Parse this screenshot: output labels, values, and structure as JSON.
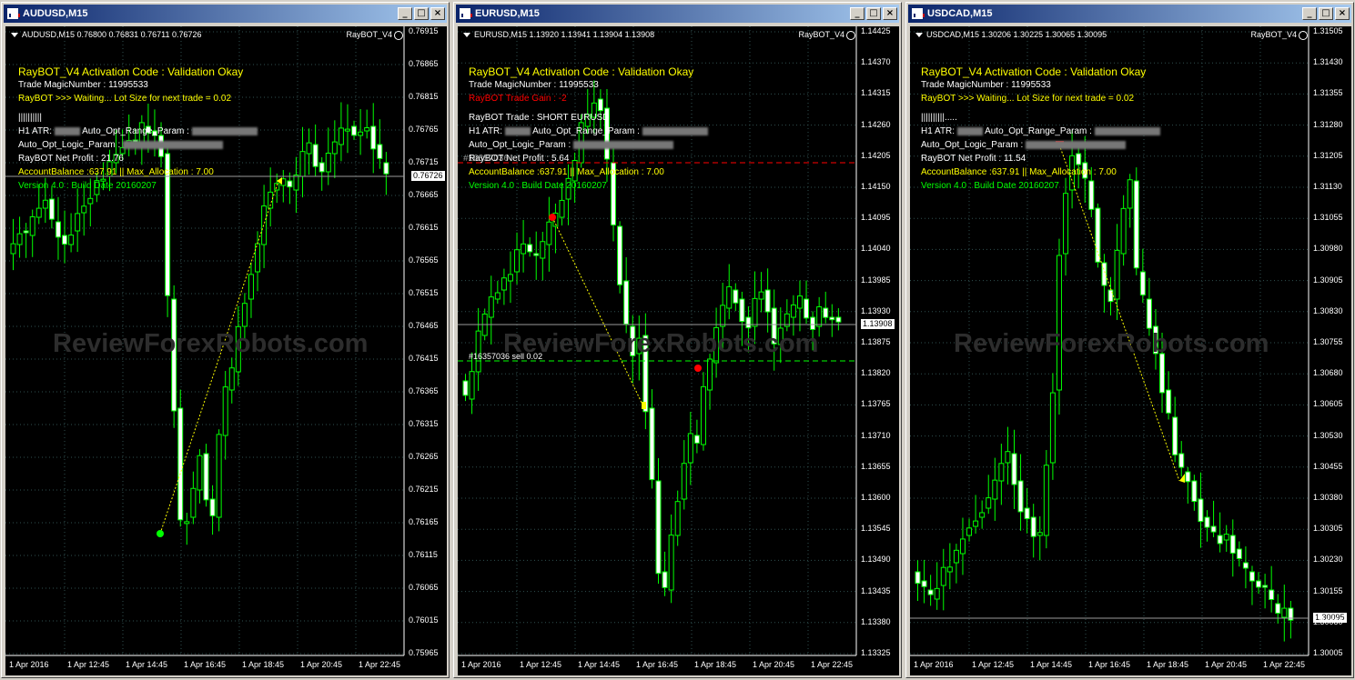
{
  "colors": {
    "bull": "#00ff00",
    "bear": "#00ff00",
    "panel_bg": "#000000",
    "grid": "#2f4f4f",
    "accent_yellow": "#ffff00",
    "red": "#ff0000"
  },
  "windows": [
    {
      "title": "AUDUSD,M15",
      "header": "AUDUSD,M15  0.76800 0.76831 0.76711 0.76726",
      "bot_label": "RayBOT_V4",
      "license": "RayBOT_V4 Activation Code : Validation Okay",
      "magic": "Trade MagicNumber : 11995533",
      "status": "RayBOT >>> Waiting... Lot Size for next trade = 0.02",
      "bars_glyph": "||||||||||",
      "atr_label": "H1 ATR:",
      "range_label": "Auto_Opt_Range_Param :",
      "logic_label": "Auto_Opt_Logic_Param :",
      "net_profit": "RayBOT Net Profit : 21.76",
      "balance": "AccountBalance :637.91 || Max_Allocation : 7.00",
      "version": "Version 4.0 : Build Date 20160207",
      "watermark": "ReviewForexRobots.com",
      "current_price": "0.76726",
      "price_labels": [
        "0.76915",
        "0.76865",
        "0.76815",
        "0.76765",
        "0.76715",
        "0.76665",
        "0.76615",
        "0.76565",
        "0.76515",
        "0.76465",
        "0.76415",
        "0.76365",
        "0.76315",
        "0.76265",
        "0.76215",
        "0.76165",
        "0.76115",
        "0.76065",
        "0.76015",
        "0.75965"
      ],
      "time_labels": [
        "1 Apr 2016",
        "1 Apr 12:45",
        "1 Apr 14:45",
        "1 Apr 16:45",
        "1 Apr 18:45",
        "1 Apr 20:45",
        "1 Apr 22:45"
      ]
    },
    {
      "title": "EURUSD,M15",
      "header": "EURUSD,M15  1.13920 1.13941 1.13904 1.13908",
      "bot_label": "RayBOT_V4",
      "license": "RayBOT_V4 Activation Code : Validation Okay",
      "magic": "Trade MagicNumber : 11995533",
      "status": "RayBOT Trade Gain : -2",
      "trade": "RayBOT Trade : SHORT EURUSD",
      "atr_label": "H1 ATR:",
      "range_label": "Auto_Opt_Range_Param :",
      "logic_label": "Auto_Opt_Logic_Param :",
      "net_profit": "RayBOT Net Profit : 5.64",
      "order_label": "#16357036",
      "balance": "AccountBalance :637.91 || Max_Allocation : 7.00",
      "version": "Version 4.0 : Build Date 20160207",
      "sell_label": "#16357036 sell 0.02",
      "watermark": "ReviewForexRobots.com",
      "current_price": "1.13908",
      "price_labels": [
        "1.14425",
        "1.14370",
        "1.14315",
        "1.14260",
        "1.14205",
        "1.14150",
        "1.14095",
        "1.14040",
        "1.13985",
        "1.13930",
        "1.13875",
        "1.13820",
        "1.13765",
        "1.13710",
        "1.13655",
        "1.13600",
        "1.13545",
        "1.13490",
        "1.13435",
        "1.13380",
        "1.13325"
      ],
      "time_labels": [
        "1 Apr 2016",
        "1 Apr 12:45",
        "1 Apr 14:45",
        "1 Apr 16:45",
        "1 Apr 18:45",
        "1 Apr 20:45",
        "1 Apr 22:45"
      ]
    },
    {
      "title": "USDCAD,M15",
      "header": "USDCAD,M15  1.30206 1.30225 1.30065 1.30095",
      "bot_label": "RayBOT_V4",
      "license": "RayBOT_V4 Activation Code : Validation Okay",
      "magic": "Trade MagicNumber : 11995533",
      "status": "RayBOT >>> Waiting... Lot Size for next trade = 0.02",
      "bars_glyph": "||||||||||.....",
      "atr_label": "H1 ATR:",
      "range_label": "Auto_Opt_Range_Param :",
      "logic_label": "Auto_Opt_Logic_Param :",
      "net_profit": "RayBOT Net Profit : 11.54",
      "balance": "AccountBalance :637.91 || Max_Allocation : 7.00",
      "version": "Version 4.0 : Build Date 20160207",
      "watermark": "ReviewForexRobots.com",
      "current_price": "1.30095",
      "price_labels": [
        "1.31505",
        "1.31430",
        "1.31355",
        "1.31280",
        "1.31205",
        "1.31130",
        "1.31055",
        "1.30980",
        "1.30905",
        "1.30830",
        "1.30755",
        "1.30680",
        "1.30605",
        "1.30530",
        "1.30455",
        "1.30380",
        "1.30305",
        "1.30230",
        "1.30155",
        "1.30080",
        "1.30005"
      ],
      "time_labels": [
        "1 Apr 2016",
        "1 Apr 12:45",
        "1 Apr 14:45",
        "1 Apr 16:45",
        "1 Apr 18:45",
        "1 Apr 20:45",
        "1 Apr 22:45"
      ]
    }
  ]
}
